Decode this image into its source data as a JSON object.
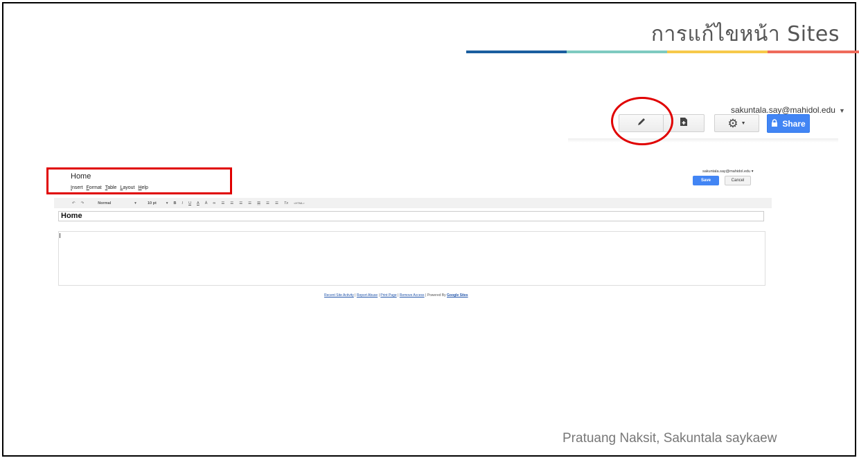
{
  "slide": {
    "title": "การแก้ไขหน้า Sites",
    "author": "Pratuang Naksit, Sakuntala  saykaew",
    "colorbar": [
      "#1b5e9f",
      "#7ecac0",
      "#f6c94a",
      "#ef6b5b"
    ]
  },
  "sites_toolbar": {
    "account_email": "sakuntala.say@mahidol.edu",
    "edit_icon": "pencil-icon",
    "new_page_icon": "new-page-icon",
    "settings_icon": "gear-icon",
    "share_label": "Share",
    "share_icon": "lock-icon"
  },
  "editor": {
    "page_name": "Home",
    "menu": [
      "Insert",
      "Format",
      "Table",
      "Layout",
      "Help"
    ],
    "account_email": "sakuntala.say@mahidol.edu",
    "save_label": "Save",
    "cancel_label": "Cancel",
    "toolbar": {
      "style": "Normal",
      "size": "10 pt",
      "html_label": "<HTML>"
    },
    "page_title": "Home"
  },
  "footer": {
    "recent": "Recent Site Activity",
    "report": "Report Abuse",
    "print": "Print Page",
    "remove": "Remove Access",
    "powered": "Powered By",
    "google_sites": "Google Sites"
  },
  "accent": {
    "share_blue": "#4285f4",
    "highlight_red": "#e00000"
  }
}
